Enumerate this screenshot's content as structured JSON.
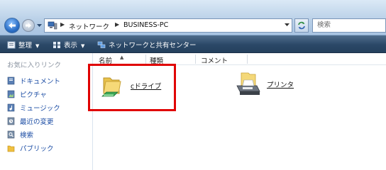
{
  "address": {
    "crumbs": [
      "ネットワーク",
      "BUSINESS-PC"
    ]
  },
  "search": {
    "placeholder": "検索"
  },
  "toolbar": {
    "organize": "整理",
    "views": "表示",
    "network_sharing": "ネットワークと共有センター"
  },
  "navpane": {
    "title": "お気に入りリンク",
    "items": [
      {
        "label": "ドキュメント",
        "icon": "document-icon"
      },
      {
        "label": "ピクチャ",
        "icon": "picture-icon"
      },
      {
        "label": "ミュージック",
        "icon": "music-icon"
      },
      {
        "label": "最近の変更",
        "icon": "recent-icon"
      },
      {
        "label": "検索",
        "icon": "search-icon"
      },
      {
        "label": "パブリック",
        "icon": "public-folder-icon"
      }
    ]
  },
  "columns": [
    "名前",
    "種類",
    "コメント"
  ],
  "items": [
    {
      "label": "cドライブ",
      "icon": "shared-folder-icon"
    },
    {
      "label": "プリンタ",
      "icon": "printer-icon"
    }
  ],
  "colors": {
    "highlight": "#e00000",
    "toolbar": "#2b4867",
    "link": "#1d4ea5"
  }
}
